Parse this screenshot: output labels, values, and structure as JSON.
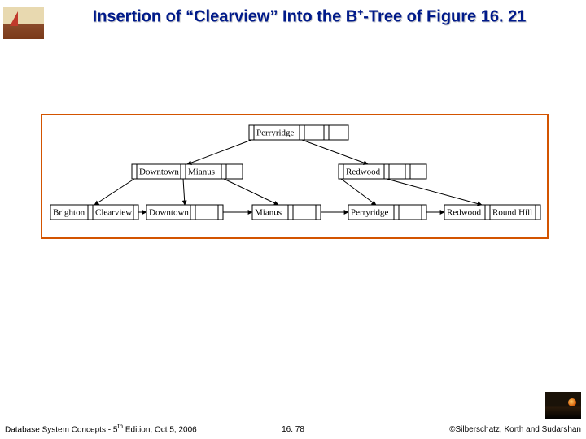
{
  "title_pre": "Insertion of “Clearview” Into the B",
  "title_sup": "+",
  "title_post": "-Tree of Figure 16. 21",
  "footer": {
    "left_pre": "Database System Concepts - 5",
    "left_sup": "th",
    "left_post": " Edition, Oct 5, 2006",
    "center": "16. 78",
    "right": "©Silberschatz, Korth and Sudarshan"
  },
  "tree": {
    "root": {
      "keys": [
        "Perryridge"
      ],
      "slots": 3
    },
    "internal": [
      {
        "keys": [
          "Downtown",
          "Mianus"
        ],
        "slots": 3
      },
      {
        "keys": [
          "Redwood"
        ],
        "slots": 3
      }
    ],
    "leaves": [
      {
        "keys": [
          "Brighton",
          "Clearview"
        ],
        "slots": 2
      },
      {
        "keys": [
          "Downtown"
        ],
        "slots": 2
      },
      {
        "keys": [
          "Mianus"
        ],
        "slots": 2
      },
      {
        "keys": [
          "Perryridge"
        ],
        "slots": 2
      },
      {
        "keys": [
          "Redwood",
          "Round Hill"
        ],
        "slots": 2
      }
    ]
  },
  "chart_data": {
    "type": "diagram",
    "structure": "B+-tree",
    "description": "B+-tree after inserting key 'Clearview'",
    "root_keys": [
      "Perryridge"
    ],
    "internal_level": [
      [
        "Downtown",
        "Mianus"
      ],
      [
        "Redwood"
      ]
    ],
    "leaf_level": [
      [
        "Brighton",
        "Clearview"
      ],
      [
        "Downtown"
      ],
      [
        "Mianus"
      ],
      [
        "Perryridge"
      ],
      [
        "Redwood",
        "Round Hill"
      ]
    ],
    "root_children": [
      0,
      1
    ],
    "internal_children": [
      [
        0,
        1,
        2
      ],
      [
        3,
        4
      ]
    ]
  }
}
